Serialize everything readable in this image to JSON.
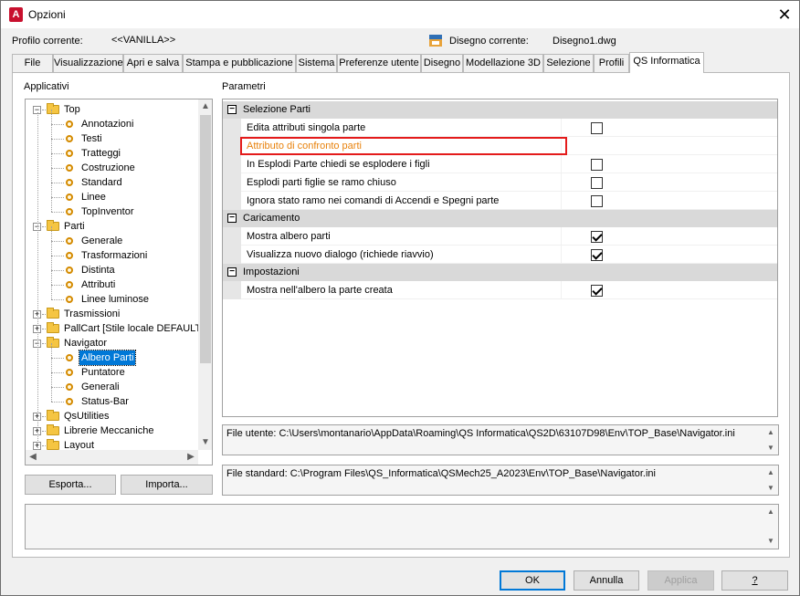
{
  "window": {
    "title": "Opzioni",
    "app_icon_letter": "A",
    "close_glyph": "✕"
  },
  "header": {
    "profile_label": "Profilo corrente:",
    "profile_value": "<<VANILLA>>",
    "drawing_label": "Disegno corrente:",
    "drawing_value": "Disegno1.dwg"
  },
  "tabs": [
    {
      "label": "File"
    },
    {
      "label": "Visualizzazione"
    },
    {
      "label": "Apri e salva"
    },
    {
      "label": "Stampa e pubblicazione"
    },
    {
      "label": "Sistema"
    },
    {
      "label": "Preferenze utente"
    },
    {
      "label": "Disegno"
    },
    {
      "label": "Modellazione 3D"
    },
    {
      "label": "Selezione"
    },
    {
      "label": "Profili"
    },
    {
      "label": "QS Informatica",
      "active": true
    }
  ],
  "left": {
    "section_label": "Applicativi",
    "tree": [
      {
        "label": "Top",
        "type": "folder",
        "expanded": true
      },
      {
        "label": "Annotazioni",
        "type": "leaf"
      },
      {
        "label": "Testi",
        "type": "leaf"
      },
      {
        "label": "Tratteggi",
        "type": "leaf"
      },
      {
        "label": "Costruzione",
        "type": "leaf"
      },
      {
        "label": "Standard",
        "type": "leaf"
      },
      {
        "label": "Linee",
        "type": "leaf"
      },
      {
        "label": "TopInventor",
        "type": "leaf"
      },
      {
        "label": "Parti",
        "type": "folder",
        "expanded": true
      },
      {
        "label": "Generale",
        "type": "leaf"
      },
      {
        "label": "Trasformazioni",
        "type": "leaf"
      },
      {
        "label": "Distinta",
        "type": "leaf"
      },
      {
        "label": "Attributi",
        "type": "leaf"
      },
      {
        "label": "Linee luminose",
        "type": "leaf"
      },
      {
        "label": "Trasmissioni",
        "type": "folder",
        "expanded": false
      },
      {
        "label": "PallCart [Stile locale DEFAULT]",
        "type": "folder",
        "expanded": false
      },
      {
        "label": "Navigator",
        "type": "folder",
        "expanded": true
      },
      {
        "label": "Albero Parti",
        "type": "leaf",
        "selected": true
      },
      {
        "label": "Puntatore",
        "type": "leaf"
      },
      {
        "label": "Generali",
        "type": "leaf"
      },
      {
        "label": "Status-Bar",
        "type": "leaf"
      },
      {
        "label": "QsUtilities",
        "type": "folder",
        "expanded": false
      },
      {
        "label": "Librerie Meccaniche",
        "type": "folder",
        "expanded": false
      },
      {
        "label": "Layout",
        "type": "folder",
        "expanded": false
      }
    ],
    "export_button": "Esporta...",
    "import_button": "Importa..."
  },
  "right": {
    "section_label": "Parametri",
    "sections": [
      {
        "title": "Selezione Parti",
        "rows": [
          {
            "label": "Edita attributi singola parte",
            "checkbox": true,
            "checked": false
          },
          {
            "label": "Attributo di confronto parti",
            "checkbox": false,
            "highlight": true
          },
          {
            "label": "In Esplodi Parte chiedi se esplodere i figli",
            "checkbox": true,
            "checked": false
          },
          {
            "label": "Esplodi parti figlie se ramo chiuso",
            "checkbox": true,
            "checked": false
          },
          {
            "label": "Ignora stato ramo nei comandi di Accendi e Spegni parte",
            "checkbox": true,
            "checked": false
          }
        ]
      },
      {
        "title": "Caricamento",
        "rows": [
          {
            "label": "Mostra albero parti",
            "checkbox": true,
            "checked": true
          },
          {
            "label": "Visualizza nuovo dialogo (richiede riavvio)",
            "checkbox": true,
            "checked": true
          }
        ]
      },
      {
        "title": "Impostazioni",
        "rows": [
          {
            "label": "Mostra nell'albero la parte creata",
            "checkbox": true,
            "checked": true
          }
        ]
      }
    ],
    "user_file": "File utente: C:\\Users\\montanario\\AppData\\Roaming\\QS Informatica\\QS2D\\63107D98\\Env\\TOP_Base\\Navigator.ini",
    "standard_file": "File standard: C:\\Program Files\\QS_Informatica\\QSMech25_A2023\\Env\\TOP_Base\\Navigator.ini"
  },
  "footer": {
    "ok": "OK",
    "cancel": "Annulla",
    "apply": "Applica",
    "help": "?"
  },
  "colors": {
    "selection": "#0078d7",
    "highlight_border": "#e41b1b",
    "highlight_text": "#e8820c",
    "section_bg": "#d9d9d9"
  }
}
